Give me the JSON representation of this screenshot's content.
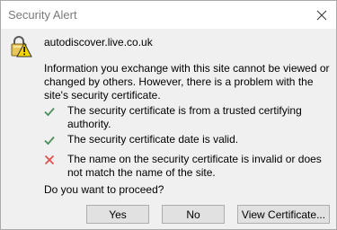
{
  "window": {
    "title": "Security Alert"
  },
  "alert": {
    "site": "autodiscover.live.co.uk",
    "info": "Information you exchange with this site cannot be viewed or changed by others. However, there is a problem with the site's security certificate.",
    "checks": [
      {
        "status": "ok",
        "icon": "green-check-icon",
        "text": "The security certificate is from a trusted certifying authority."
      },
      {
        "status": "ok",
        "icon": "green-check-icon",
        "text": "The security certificate date is valid."
      },
      {
        "status": "error",
        "icon": "red-x-icon",
        "text": "The name on the security certificate is invalid or does not match the name of the site."
      }
    ],
    "question": "Do you want to proceed?"
  },
  "buttons": {
    "yes": "Yes",
    "no": "No",
    "view_certificate": "View Certificate..."
  },
  "colors": {
    "check": "#4c8f5c",
    "error": "#d9534f",
    "warning_yellow": "#f5d400"
  }
}
